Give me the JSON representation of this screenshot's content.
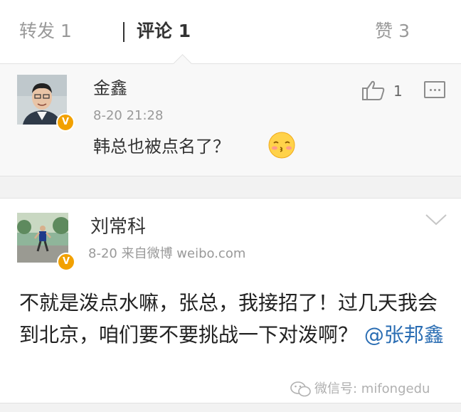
{
  "tabs": {
    "repost": "转发 1",
    "comment": "评论 1",
    "like": "赞 3"
  },
  "comments": [
    {
      "author": "金鑫",
      "time": "8-20  21:28",
      "text": "韩总也被点名了？",
      "emoji": "kiss-face-emoji",
      "likes": "1",
      "verified": true
    },
    {
      "author": "刘常科",
      "time": "8-20  来自微博 weibo.com",
      "text": "不就是泼点水嘛，张总，我接招了！过几天我会到北京，咱们要不要挑战一下对泼啊？",
      "mention": "@张邦鑫",
      "verified": true
    }
  ],
  "watermark": "微信号: mifongedu",
  "colors": {
    "verified_badge": "#f2a100",
    "mention": "#2a6db3",
    "background": "#f2f2f2"
  }
}
